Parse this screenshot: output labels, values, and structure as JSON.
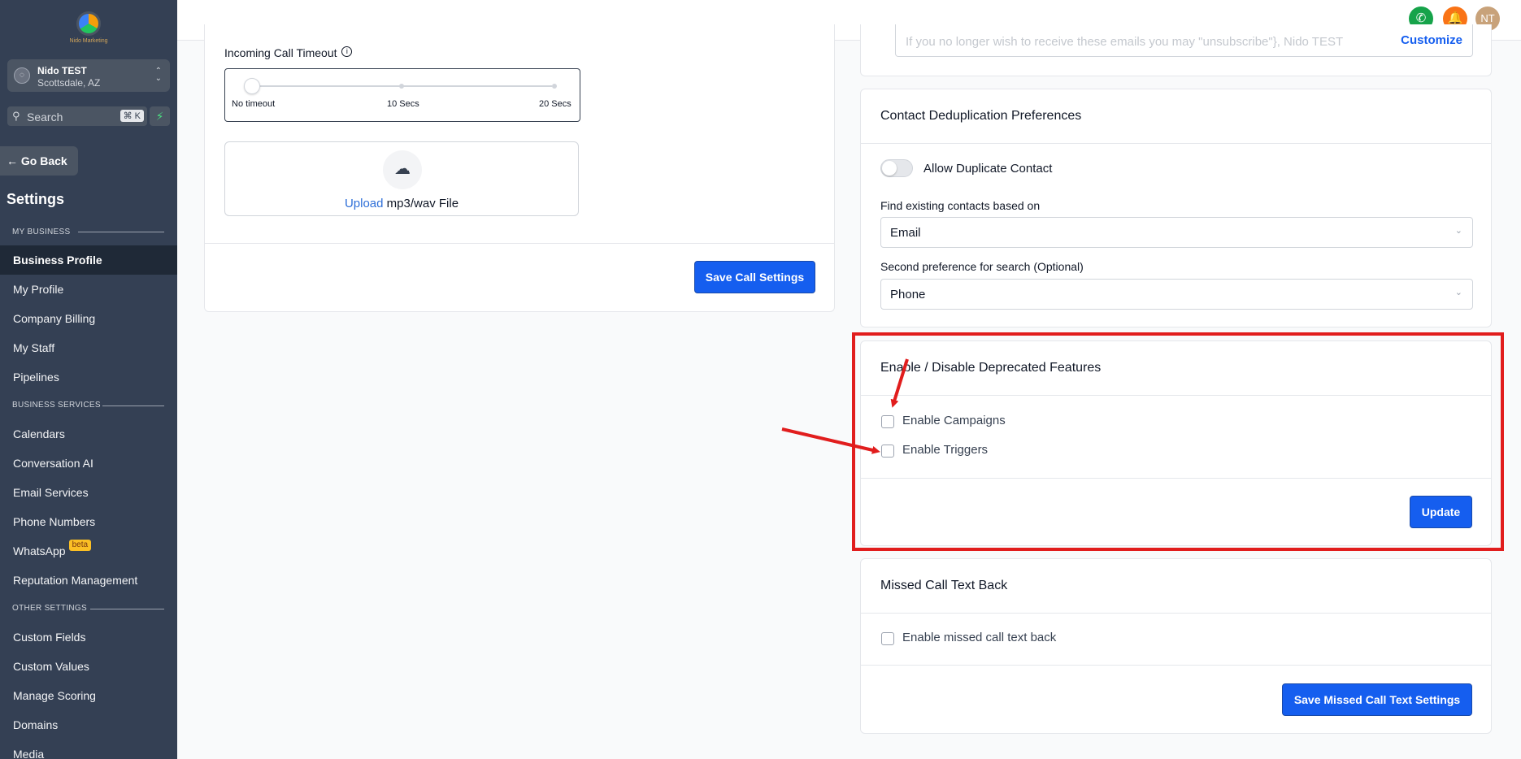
{
  "sidebar": {
    "logo_text": "Nido Marketing",
    "account": {
      "name": "Nido TEST",
      "location": "Scottsdale, AZ",
      "avatar_icon": "user-icon"
    },
    "search": {
      "placeholder": "Search",
      "shortcut": "⌘ K"
    },
    "go_back": "Go Back",
    "title": "Settings",
    "sections": {
      "my_business": "MY BUSINESS",
      "business_services": "BUSINESS SERVICES",
      "other_settings": "OTHER SETTINGS"
    },
    "items": {
      "business_profile": "Business Profile",
      "my_profile": "My Profile",
      "company_billing": "Company Billing",
      "my_staff": "My Staff",
      "pipelines": "Pipelines",
      "calendars": "Calendars",
      "conversation_ai": "Conversation AI",
      "email_services": "Email Services",
      "phone_numbers": "Phone Numbers",
      "whatsapp": "WhatsApp",
      "whatsapp_badge": "beta",
      "reputation_management": "Reputation Management",
      "custom_fields": "Custom Fields",
      "custom_values": "Custom Values",
      "manage_scoring": "Manage Scoring",
      "domains": "Domains",
      "media": "Media"
    }
  },
  "header": {
    "user_initials": "NT"
  },
  "call_settings": {
    "timeout_label": "Incoming Call Timeout",
    "timeout_ticks": [
      "No timeout",
      "10 Secs",
      "20 Secs"
    ],
    "timeout_value_fraction": 0.0,
    "upload_link": "Upload",
    "upload_suffix": "mp3/wav File",
    "save_button": "Save Call Settings"
  },
  "email_footer": {
    "text": "If you no longer wish to receive these emails you may \"unsubscribe\"}, Nido TEST",
    "customize": "Customize"
  },
  "dedup": {
    "title": "Contact Deduplication Preferences",
    "allow_label": "Allow Duplicate Contact",
    "find_label": "Find existing contacts based on",
    "find_value": "Email",
    "second_label": "Second preference for search (Optional)",
    "second_value": "Phone"
  },
  "deprecated": {
    "title": "Enable / Disable Deprecated Features",
    "campaigns": "Enable Campaigns",
    "triggers": "Enable Triggers",
    "update_button": "Update",
    "highlight_color": "#e11d1d"
  },
  "missed_call": {
    "title": "Missed Call Text Back",
    "enable_label": "Enable missed call text back",
    "save_button": "Save Missed Call Text Settings"
  }
}
